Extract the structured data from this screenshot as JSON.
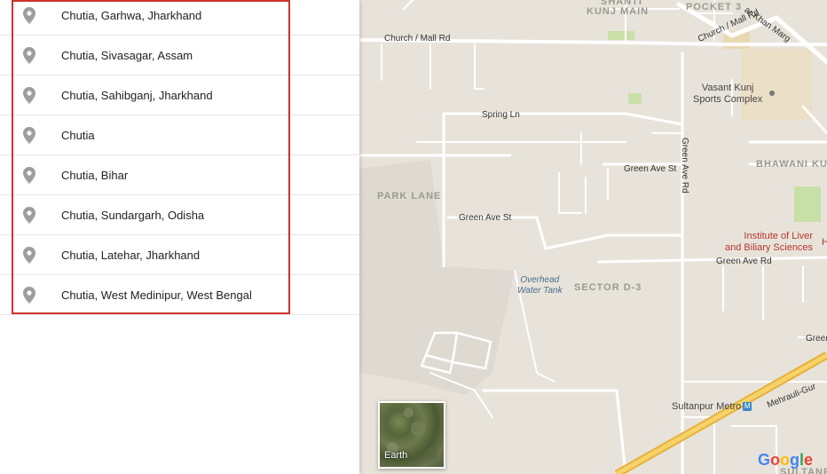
{
  "results": [
    {
      "label": "Chutia, Garhwa, Jharkhand"
    },
    {
      "label": "Chutia, Sivasagar, Assam"
    },
    {
      "label": "Chutia, Sahibganj, Jharkhand"
    },
    {
      "label": "Chutia"
    },
    {
      "label": "Chutia, Bihar"
    },
    {
      "label": "Chutia, Sundargarh, Odisha"
    },
    {
      "label": "Chutia, Latehar, Jharkhand"
    },
    {
      "label": "Chutia, West Medinipur, West Bengal"
    }
  ],
  "map": {
    "labels": {
      "shanti_kunj_main_top": "SHANTI",
      "kunj_main": "KUNJ MAIN",
      "pocket_3": "POCKET 3",
      "khan_marg": "ar Khan Marg",
      "church_mall_rd_left": "Church / Mall Rd",
      "church_mall_rd_right": "Church / Mall Rd",
      "vasant_kunj_sports": "Vasant Kunj\nSports Complex",
      "spring_ln": "Spring Ln",
      "green_ave_rd_vertical": "Green Ave Rd",
      "green_ave_st_1": "Green Ave St",
      "bhawani_ku": "BHAWANI KU",
      "park_lane": "PARK LANE",
      "green_ave_st_2": "Green Ave St",
      "institute": "Institute of Liver\nand Biliary Sciences",
      "green_ave_rd_2": "Green Ave Rd",
      "overhead_water_tank": "Overhead\nWater Tank",
      "sector_d3": "SECTOR D-3",
      "green_partial": "Green",
      "sultanpur_metro": "Sultanpur Metro",
      "metro_letter": "M",
      "mehrauli": "Mehrauli-Gur",
      "sultanpur_bottom": "SULTANP",
      "h_partial": "H"
    },
    "earth_label": "Earth",
    "google_logo": [
      "G",
      "o",
      "o",
      "g",
      "l",
      "e"
    ],
    "colors": {
      "background": "#e8e3da",
      "road": "#ffffff",
      "highway": "#f4c542",
      "park": "#c8dfa8",
      "pin": "#9e9e9e",
      "highlight": "#d0312d"
    }
  }
}
